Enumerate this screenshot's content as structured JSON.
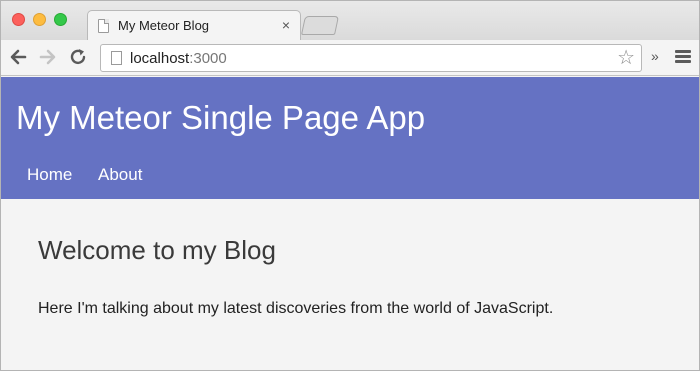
{
  "browser": {
    "tab_title": "My Meteor Blog",
    "tab_close": "×",
    "url_host": "localhost",
    "url_port": ":3000",
    "extensions_chevron": "»"
  },
  "page": {
    "app_title": "My Meteor Single Page App",
    "nav": {
      "home": "Home",
      "about": "About"
    },
    "heading": "Welcome to my Blog",
    "paragraph": "Here I'm talking about my latest discoveries from the world of JavaScript."
  },
  "colors": {
    "header_bg": "#6572c3",
    "page_bg": "#f4f4f4"
  },
  "icons": [
    "close-window-icon",
    "minimize-window-icon",
    "maximize-window-icon",
    "page-icon",
    "back-arrow-icon",
    "forward-arrow-icon",
    "reload-icon",
    "star-icon",
    "menu-icon"
  ]
}
